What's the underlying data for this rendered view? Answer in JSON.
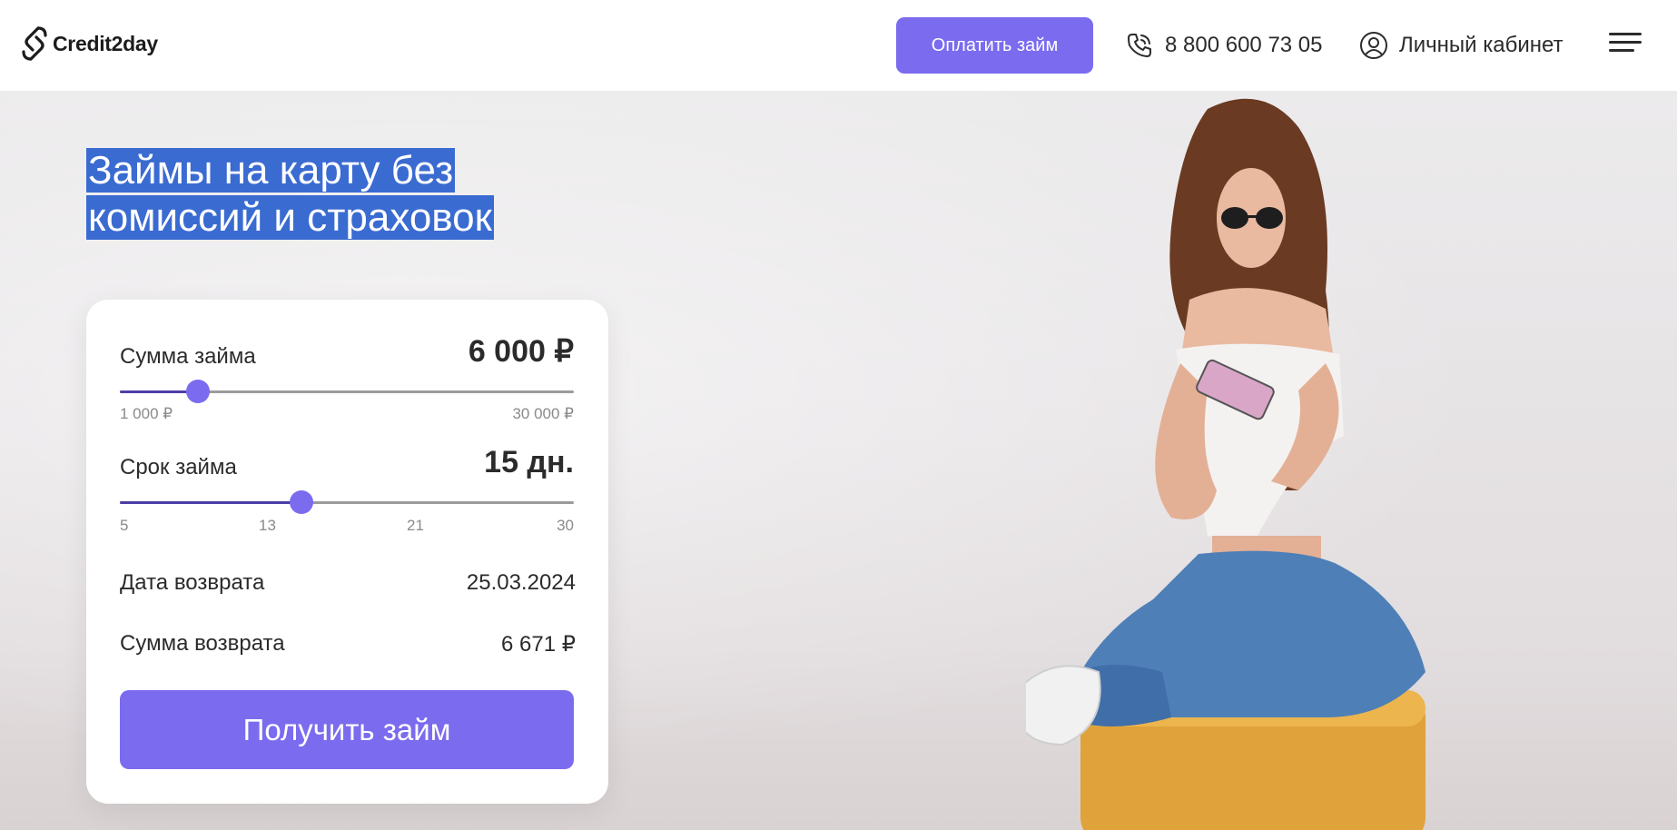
{
  "header": {
    "logo_text": "Credit2day",
    "pay_button": "Оплатить займ",
    "phone": "8 800 600 73 05",
    "account": "Личный кабинет",
    "icons": [
      "logo-icon",
      "phone-icon",
      "user-icon",
      "menu-icon"
    ]
  },
  "hero": {
    "title_line1": "Займы на карту без",
    "title_line2": "комиссий и страховок"
  },
  "calculator": {
    "amount": {
      "label": "Сумма займа",
      "value": "6 000 ₽",
      "min_label": "1 000 ₽",
      "max_label": "30 000 ₽",
      "min": 1000,
      "max": 30000,
      "current": 6000
    },
    "term": {
      "label": "Срок займа",
      "value": "15 дн.",
      "ticks": [
        "5",
        "13",
        "21",
        "30"
      ],
      "min": 5,
      "max": 30,
      "current": 15
    },
    "return_date": {
      "label": "Дата возврата",
      "value": "25.03.2024"
    },
    "return_sum": {
      "label": "Сумма возврата",
      "value": "6 671 ₽"
    },
    "submit": "Получить займ"
  },
  "colors": {
    "accent": "#7b6bef",
    "slider_fill": "#4b3fa6",
    "title_highlight": "#3a6bd1"
  }
}
